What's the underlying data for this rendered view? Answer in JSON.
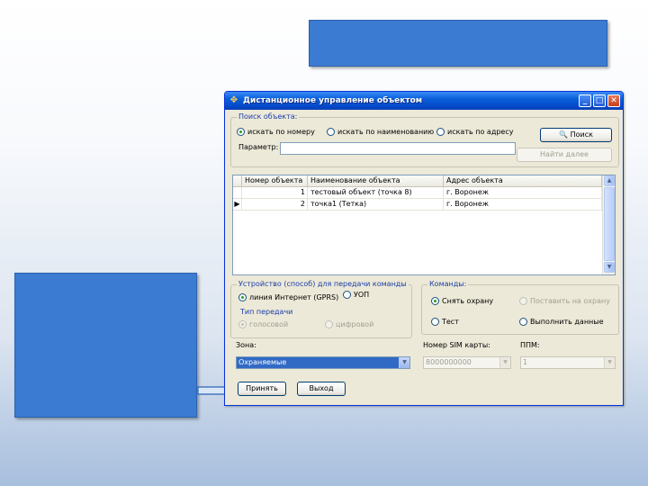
{
  "window": {
    "title": "Дистанционное управление объектом",
    "buttons": {
      "minimize": "_",
      "maximize": "□",
      "close": "✕"
    }
  },
  "search": {
    "group_label": "Поиск объекта:",
    "radio_by_number": "искать по номеру",
    "radio_by_name": "искать по наименованию",
    "radio_by_address": "искать по адресу",
    "parameter_label": "Параметр:",
    "parameter_value": "",
    "search_button": "Поиск",
    "find_next_button": "Найти далее"
  },
  "objects_table": {
    "columns": [
      "Номер объекта",
      "Наименование объекта",
      "Адрес объекта"
    ],
    "rows": [
      {
        "selected": false,
        "number": "1",
        "name": "тестовый объект (точка 8)",
        "address": "г. Воронеж"
      },
      {
        "selected": true,
        "number": "2",
        "name": "точка1 (Тетка)",
        "address": "г. Воронеж"
      }
    ]
  },
  "device": {
    "group_label": "Устройство (способ) для передачи команды",
    "radio_internet": "линия Интернет (GPRS)",
    "radio_uop": "УОП",
    "transfer_type_label": "Тип передачи",
    "radio_voice": "голосовой",
    "radio_digital": "цифровой"
  },
  "commands": {
    "group_label": "Команды:",
    "radio_remove_guard": "Снять охрану",
    "radio_set_guard": "Поставить на охрану",
    "radio_test": "Тест",
    "radio_execute": "Выполнить данные"
  },
  "zone": {
    "label": "Зона:",
    "value": "Охраняемые",
    "arrow": "▼"
  },
  "sim": {
    "label": "Номер SIM карты:",
    "value": "8000000000",
    "arrow": "▼"
  },
  "ppm": {
    "label": "ППМ:",
    "value": "1",
    "arrow": "▼"
  },
  "footer": {
    "apply_button": "Принять",
    "exit_button": "Выход"
  },
  "colors": {
    "accent_blue": "#3b7bd1",
    "title_bar": "#0a5fd8",
    "window_bg": "#ece9d8",
    "selection": "#316ac5"
  }
}
